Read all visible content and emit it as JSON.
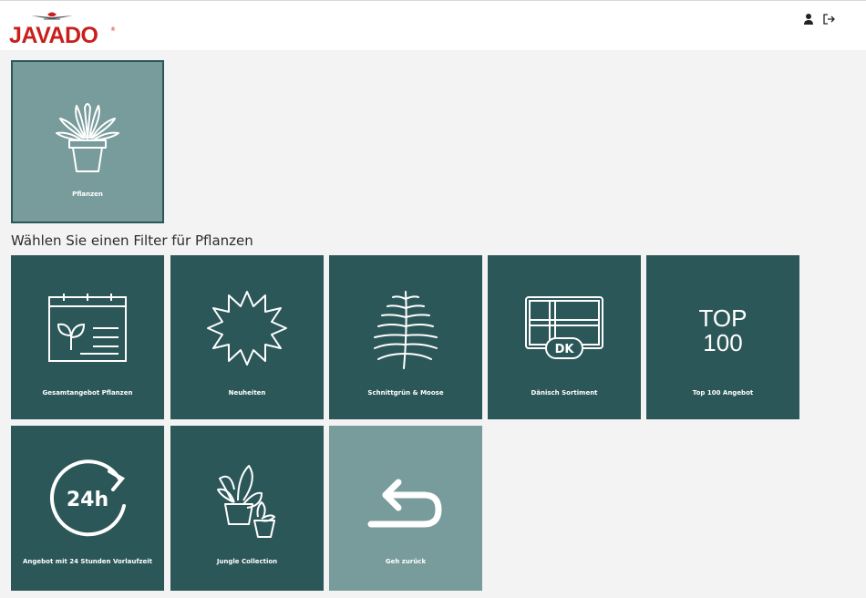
{
  "header": {
    "logo_text": "JAVADO",
    "icons": [
      "user-icon",
      "logout-icon"
    ]
  },
  "category": {
    "label": "Pflanzen",
    "icon": "potted-plant-icon"
  },
  "filter_heading": "Wählen Sie einen Filter für Pflanzen",
  "filters": [
    {
      "label": "Gesamtangebot Pflanzen",
      "icon": "catalog-leaf-icon"
    },
    {
      "label": "Neuheiten",
      "icon": "starburst-icon"
    },
    {
      "label": "Schnittgrün & Moose",
      "icon": "fern-icon"
    },
    {
      "label": "Dänisch Sortiment",
      "icon": "danish-flag-icon"
    },
    {
      "label": "Top 100 Angebot",
      "icon": "top100-icon",
      "icon_text_line1": "TOP",
      "icon_text_line2": "100"
    },
    {
      "label": "Angebot mit 24 Stunden Vorlaufzeit",
      "icon": "24h-clock-icon",
      "icon_text": "24h"
    },
    {
      "label": "Jungle Collection",
      "icon": "house-plants-icon"
    },
    {
      "label": "Geh zurück",
      "icon": "back-arrow-icon"
    }
  ],
  "colors": {
    "tile_dark": "#2c5759",
    "tile_light": "#789b9b",
    "brand_red": "#c8201e",
    "background": "#f3f3f3"
  }
}
